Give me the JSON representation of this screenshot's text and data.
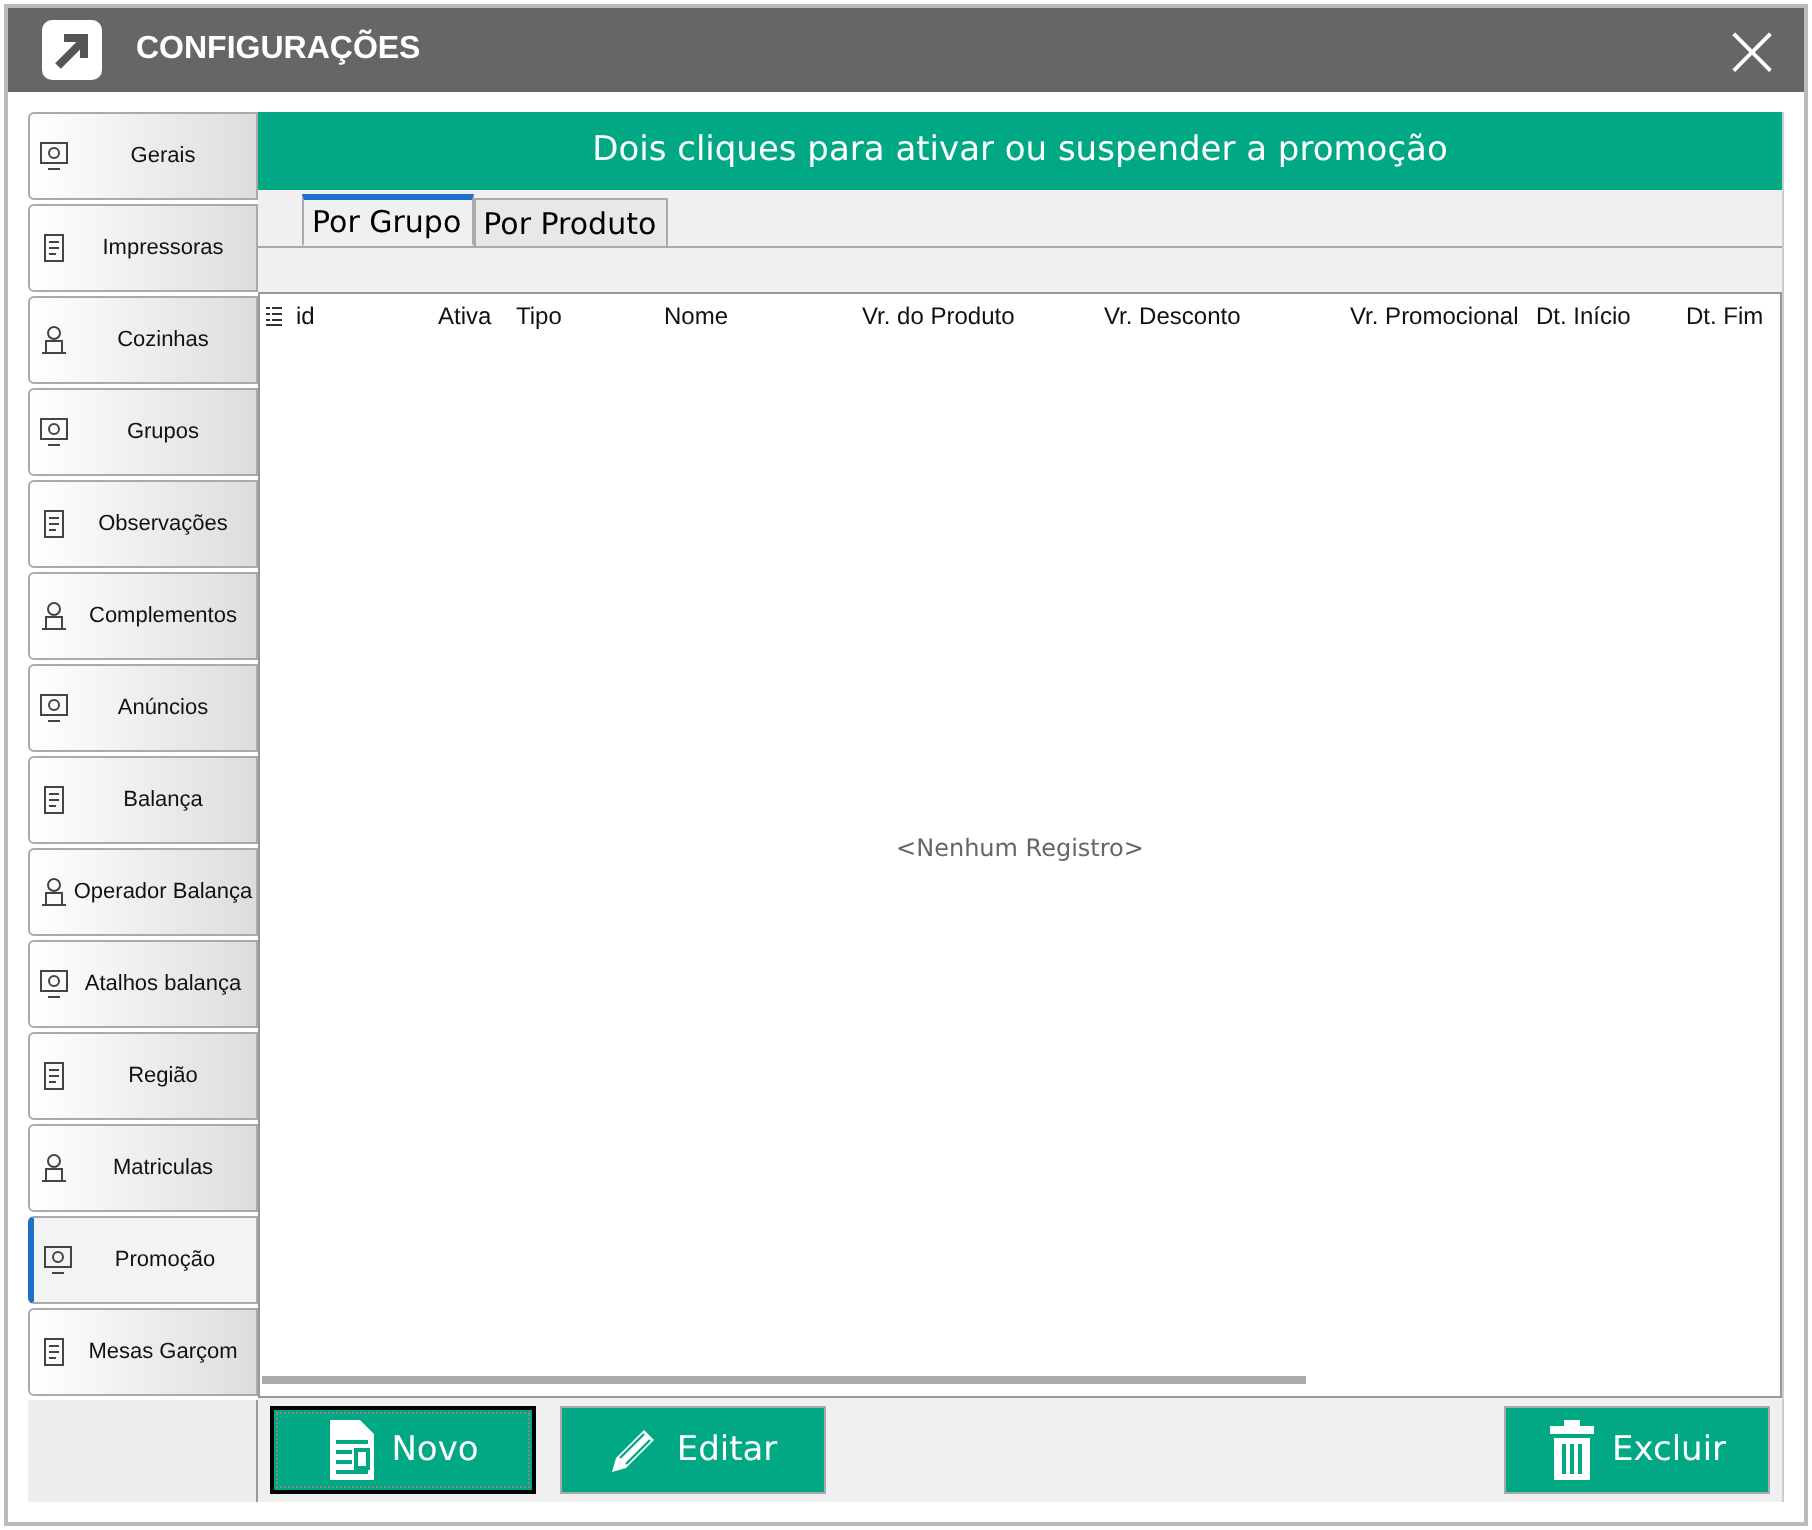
{
  "window": {
    "title": "CONFIGURAÇÕES",
    "close_symbol": "×"
  },
  "sidebar": {
    "items": [
      {
        "label": "Gerais",
        "selected": false
      },
      {
        "label": "Impressoras",
        "selected": false
      },
      {
        "label": "Cozinhas",
        "selected": false
      },
      {
        "label": "Grupos",
        "selected": false
      },
      {
        "label": "Observações",
        "selected": false
      },
      {
        "label": "Complementos",
        "selected": false
      },
      {
        "label": "Anúncios",
        "selected": false
      },
      {
        "label": "Balança",
        "selected": false
      },
      {
        "label": "Operador  Balança",
        "selected": false
      },
      {
        "label": "Atalhos balança",
        "selected": false
      },
      {
        "label": "Região",
        "selected": false
      },
      {
        "label": "Matriculas",
        "selected": false
      },
      {
        "label": "Promoção",
        "selected": true
      },
      {
        "label": "Mesas Garçom",
        "selected": false
      }
    ]
  },
  "banner": "Dois cliques para ativar ou suspender a promoção",
  "tabs": [
    {
      "label": "Por Grupo",
      "selected": true
    },
    {
      "label": "Por Produto",
      "selected": false
    }
  ],
  "table": {
    "columns": [
      "id",
      "Ativa",
      "Tipo",
      "Nome",
      "Vr. do Produto",
      "Vr. Desconto",
      "Vr. Promocional",
      "Dt. Início",
      "Dt. Fim"
    ],
    "empty_text": "<Nenhum Registro>"
  },
  "buttons": [
    {
      "label": "Novo",
      "kind": "new",
      "focused": true
    },
    {
      "label": "Editar",
      "kind": "edit",
      "focused": false
    },
    {
      "label": "Excluir",
      "kind": "delete",
      "focused": false
    }
  ]
}
